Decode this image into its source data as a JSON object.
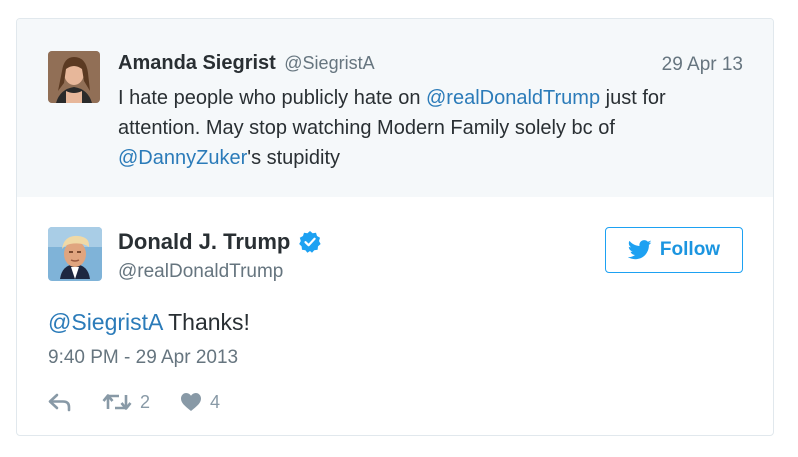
{
  "parent_tweet": {
    "author_name": "Amanda Siegrist",
    "author_handle": "@SiegristA",
    "date": "29 Apr 13",
    "text_part1": "I hate people who publicly hate on ",
    "mention1": "@realDonaldTrump",
    "text_part2": " just for attention. May stop watching Modern Family solely bc of ",
    "mention2": "@DannyZuker",
    "text_part3": "'s stupidity"
  },
  "main_tweet": {
    "author_name": "Donald J. Trump",
    "author_handle": "@realDonaldTrump",
    "verified_icon": "verified-badge-icon",
    "mention": "@SiegristA",
    "text": " Thanks!",
    "timestamp": "9:40 PM - 29 Apr 2013",
    "retweet_count": "2",
    "like_count": "4"
  },
  "follow_button": {
    "label": "Follow",
    "icon": "twitter-bird-icon"
  },
  "colors": {
    "link": "#2b7bb9",
    "brand_blue": "#1da1f2",
    "muted": "#66757f",
    "action_gray": "#8899a6",
    "parent_bg": "#f5f8fa"
  }
}
